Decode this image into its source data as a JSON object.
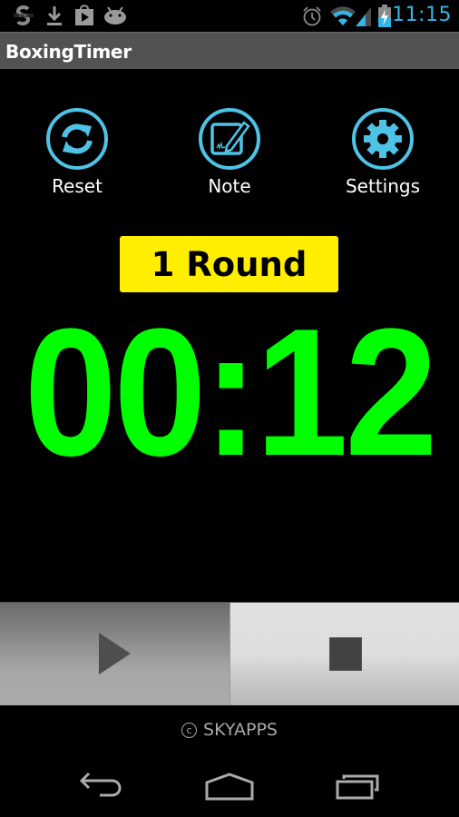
{
  "status_bar": {
    "left_icons": [
      "sync-app-icon",
      "download-icon",
      "play-store-icon",
      "android-icon"
    ],
    "right_icons": [
      "alarm-icon",
      "wifi-icon",
      "cell-signal-icon",
      "battery-charging-icon"
    ],
    "time": "11:15",
    "accent_color": "#33b5e5"
  },
  "action_bar": {
    "title": "BoxingTimer"
  },
  "tools": [
    {
      "label": "Reset",
      "icon": "refresh-icon"
    },
    {
      "label": "Note",
      "icon": "note-edit-icon"
    },
    {
      "label": "Settings",
      "icon": "gear-icon"
    }
  ],
  "round": {
    "label": "1 Round",
    "background_color": "#ffee00"
  },
  "timer": {
    "value": "00:12",
    "color": "#00ff00"
  },
  "controls": {
    "play": {
      "icon": "play-icon",
      "state": "active"
    },
    "stop": {
      "icon": "stop-icon",
      "state": "inactive"
    }
  },
  "footer": {
    "copyright_symbol": "c",
    "copyright_text": "SKYAPPS"
  },
  "nav_bar": {
    "buttons": [
      "back-icon",
      "home-icon",
      "recent-apps-icon"
    ]
  }
}
